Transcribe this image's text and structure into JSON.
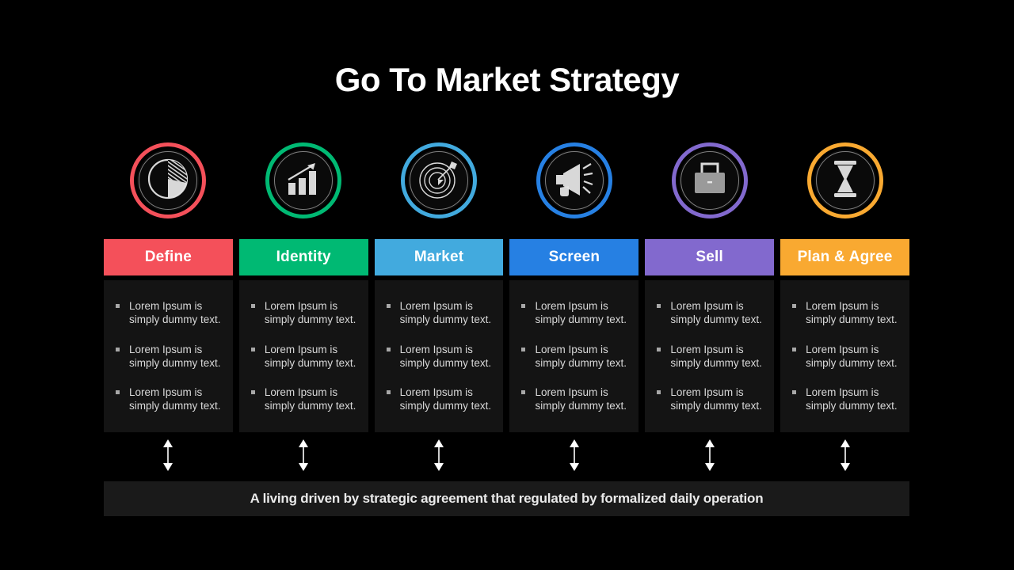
{
  "slide": {
    "title": "Go To Market Strategy",
    "background_color": "#000000",
    "panel_color": "#141414",
    "banner_color": "#1a1a1a"
  },
  "columns": [
    {
      "label": "Define",
      "color": "#f4505a",
      "icon": "pie-chart-icon",
      "bullets": [
        "Lorem Ipsum is simply dummy text.",
        "Lorem Ipsum is simply dummy text.",
        "Lorem Ipsum is simply dummy text."
      ]
    },
    {
      "label": "Identity",
      "color": "#00b973",
      "icon": "bar-chart-growth-icon",
      "bullets": [
        "Lorem Ipsum is simply dummy text.",
        "Lorem Ipsum is simply dummy text.",
        "Lorem Ipsum is simply dummy text."
      ]
    },
    {
      "label": "Market",
      "color": "#42aade",
      "icon": "target-arrow-icon",
      "bullets": [
        "Lorem Ipsum is simply dummy text.",
        "Lorem Ipsum is simply dummy text.",
        "Lorem Ipsum is simply dummy text."
      ]
    },
    {
      "label": "Screen",
      "color": "#2680e3",
      "icon": "megaphone-icon",
      "bullets": [
        "Lorem Ipsum is simply dummy text.",
        "Lorem Ipsum is simply dummy text.",
        "Lorem Ipsum is simply dummy text."
      ]
    },
    {
      "label": "Sell",
      "color": "#8269ce",
      "icon": "briefcase-icon",
      "bullets": [
        "Lorem Ipsum is simply dummy text.",
        "Lorem Ipsum is simply dummy text.",
        "Lorem Ipsum is simply dummy text."
      ]
    },
    {
      "label": "Plan & Agree",
      "color": "#f9a931",
      "icon": "hourglass-icon",
      "bullets": [
        "Lorem Ipsum is simply dummy text.",
        "Lorem Ipsum is simply dummy text.",
        "Lorem Ipsum is simply dummy text."
      ]
    }
  ],
  "connector": {
    "icon": "double-arrow-vertical-icon",
    "color": "#ffffff"
  },
  "banner": {
    "text": "A living driven by strategic agreement that regulated by formalized daily operation"
  }
}
